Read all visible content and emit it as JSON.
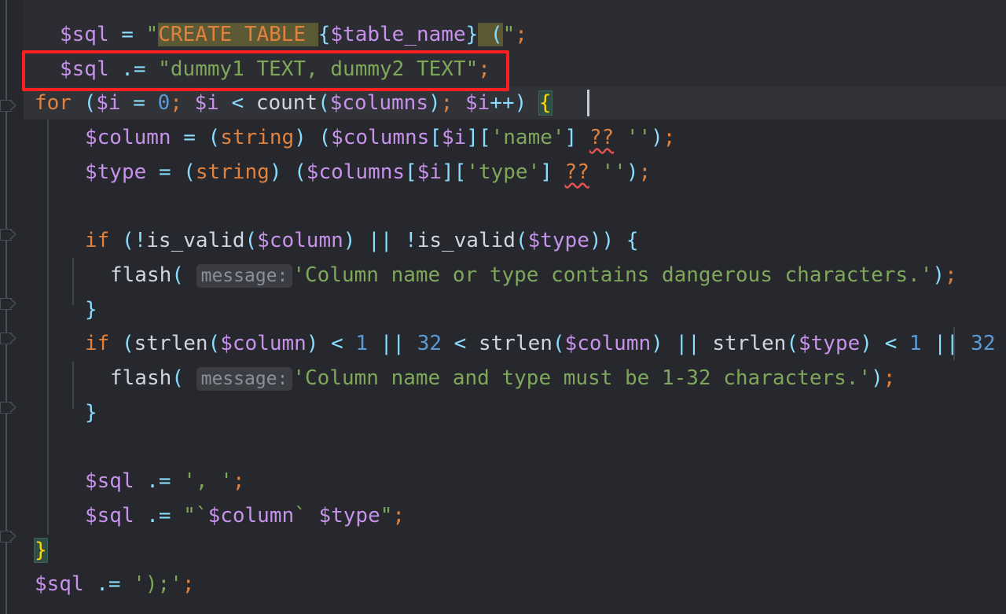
{
  "editor": {
    "language": "php",
    "theme_background": "#26282e",
    "selection_band_background": "#2b2d33",
    "current_line_background": "#313339",
    "annotation_color": "#ff2020",
    "cursor_color": "#c6ccd6",
    "highlight_background": "#5c5a34",
    "brace_match_background": "#2f4f46",
    "inlay_hint_background": "#3b3d43",
    "squiggle_color": "#e05252"
  },
  "annotation": {
    "name": "red-highlight-rectangle",
    "targets_line": 2,
    "label": ""
  },
  "inlay_hints": [
    {
      "text": "message:"
    },
    {
      "text": "message:"
    }
  ],
  "code_lines": [
    {
      "n": 1,
      "indent": 1,
      "text": "$sql = \"CREATE TABLE {$table_name} (\";",
      "tokens": [
        {
          "t": "$sql",
          "c": "var"
        },
        {
          "t": " ",
          "c": "plain"
        },
        {
          "t": "=",
          "c": "op"
        },
        {
          "t": " ",
          "c": "plain"
        },
        {
          "t": "\"",
          "c": "str"
        },
        {
          "t": "CREATE TABLE ",
          "c": "kw",
          "hl": "sql"
        },
        {
          "t": "{",
          "c": "op",
          "hl": "interp"
        },
        {
          "t": "$table_name",
          "c": "strp",
          "hl": "interp"
        },
        {
          "t": "}",
          "c": "op",
          "hl": "interp"
        },
        {
          "t": " (",
          "c": "op",
          "hl": "sql"
        },
        {
          "t": "\"",
          "c": "str"
        },
        {
          "t": ";",
          "c": "semi"
        }
      ]
    },
    {
      "n": 2,
      "indent": 1,
      "text": "$sql .= \"dummy1 TEXT, dummy2 TEXT\";",
      "tokens": [
        {
          "t": "$sql",
          "c": "var"
        },
        {
          "t": " ",
          "c": "plain"
        },
        {
          "t": ".=",
          "c": "op"
        },
        {
          "t": " ",
          "c": "plain"
        },
        {
          "t": "\"dummy1 TEXT, dummy2 TEXT\"",
          "c": "str"
        },
        {
          "t": ";",
          "c": "semi"
        }
      ]
    },
    {
      "n": 3,
      "indent": 0,
      "text": "for ($i = 0; $i < count($columns); $i++) {",
      "tokens": [
        {
          "t": "for",
          "c": "kw"
        },
        {
          "t": " ",
          "c": "plain"
        },
        {
          "t": "(",
          "c": "op"
        },
        {
          "t": "$i",
          "c": "var"
        },
        {
          "t": " ",
          "c": "plain"
        },
        {
          "t": "=",
          "c": "op"
        },
        {
          "t": " ",
          "c": "plain"
        },
        {
          "t": "0",
          "c": "num"
        },
        {
          "t": ";",
          "c": "semi"
        },
        {
          "t": " ",
          "c": "plain"
        },
        {
          "t": "$i",
          "c": "var"
        },
        {
          "t": " ",
          "c": "plain"
        },
        {
          "t": "<",
          "c": "op"
        },
        {
          "t": " ",
          "c": "plain"
        },
        {
          "t": "count",
          "c": "fn"
        },
        {
          "t": "(",
          "c": "op"
        },
        {
          "t": "$columns",
          "c": "var"
        },
        {
          "t": ")",
          "c": "op"
        },
        {
          "t": ";",
          "c": "semi"
        },
        {
          "t": " ",
          "c": "plain"
        },
        {
          "t": "$i",
          "c": "var"
        },
        {
          "t": "++",
          "c": "op"
        },
        {
          "t": ")",
          "c": "op"
        },
        {
          "t": " ",
          "c": "plain"
        },
        {
          "t": "{",
          "c": "brace",
          "hl": "brace"
        }
      ]
    },
    {
      "n": 4,
      "indent": 2,
      "text": "$column = (string) ($columns[$i]['name'] ?? '');",
      "tokens": [
        {
          "t": "$column",
          "c": "var"
        },
        {
          "t": " ",
          "c": "plain"
        },
        {
          "t": "=",
          "c": "op"
        },
        {
          "t": " ",
          "c": "plain"
        },
        {
          "t": "(",
          "c": "op"
        },
        {
          "t": "string",
          "c": "cast"
        },
        {
          "t": ")",
          "c": "op"
        },
        {
          "t": " ",
          "c": "plain"
        },
        {
          "t": "(",
          "c": "op"
        },
        {
          "t": "$columns",
          "c": "var"
        },
        {
          "t": "[",
          "c": "op"
        },
        {
          "t": "$i",
          "c": "var"
        },
        {
          "t": "]",
          "c": "op"
        },
        {
          "t": "[",
          "c": "op"
        },
        {
          "t": "'name'",
          "c": "str"
        },
        {
          "t": "]",
          "c": "op"
        },
        {
          "t": " ",
          "c": "plain"
        },
        {
          "t": "??",
          "c": "kw",
          "squiggle": true
        },
        {
          "t": " ",
          "c": "plain"
        },
        {
          "t": "''",
          "c": "str"
        },
        {
          "t": ")",
          "c": "op"
        },
        {
          "t": ";",
          "c": "semi"
        }
      ]
    },
    {
      "n": 5,
      "indent": 2,
      "text": "$type = (string) ($columns[$i]['type'] ?? '');",
      "tokens": [
        {
          "t": "$type",
          "c": "var"
        },
        {
          "t": " ",
          "c": "plain"
        },
        {
          "t": "=",
          "c": "op"
        },
        {
          "t": " ",
          "c": "plain"
        },
        {
          "t": "(",
          "c": "op"
        },
        {
          "t": "string",
          "c": "cast"
        },
        {
          "t": ")",
          "c": "op"
        },
        {
          "t": " ",
          "c": "plain"
        },
        {
          "t": "(",
          "c": "op"
        },
        {
          "t": "$columns",
          "c": "var"
        },
        {
          "t": "[",
          "c": "op"
        },
        {
          "t": "$i",
          "c": "var"
        },
        {
          "t": "]",
          "c": "op"
        },
        {
          "t": "[",
          "c": "op"
        },
        {
          "t": "'type'",
          "c": "str"
        },
        {
          "t": "]",
          "c": "op"
        },
        {
          "t": " ",
          "c": "plain"
        },
        {
          "t": "??",
          "c": "kw",
          "squiggle": true
        },
        {
          "t": " ",
          "c": "plain"
        },
        {
          "t": "''",
          "c": "str"
        },
        {
          "t": ")",
          "c": "op"
        },
        {
          "t": ";",
          "c": "semi"
        }
      ]
    },
    {
      "n": 6,
      "indent": 0,
      "text": "",
      "tokens": []
    },
    {
      "n": 7,
      "indent": 2,
      "text": "if (!is_valid($column) || !is_valid($type)) {",
      "tokens": [
        {
          "t": "if",
          "c": "kw"
        },
        {
          "t": " ",
          "c": "plain"
        },
        {
          "t": "(!",
          "c": "op"
        },
        {
          "t": "is_valid",
          "c": "fn"
        },
        {
          "t": "(",
          "c": "op"
        },
        {
          "t": "$column",
          "c": "var"
        },
        {
          "t": ")",
          "c": "op"
        },
        {
          "t": " ",
          "c": "plain"
        },
        {
          "t": "||",
          "c": "op"
        },
        {
          "t": " !",
          "c": "op"
        },
        {
          "t": "is_valid",
          "c": "fn"
        },
        {
          "t": "(",
          "c": "op"
        },
        {
          "t": "$type",
          "c": "var"
        },
        {
          "t": "))",
          "c": "op"
        },
        {
          "t": " ",
          "c": "plain"
        },
        {
          "t": "{",
          "c": "op"
        }
      ]
    },
    {
      "n": 8,
      "indent": 3,
      "text": "flash( message: 'Column name or type contains dangerous characters.');",
      "tokens": [
        {
          "t": "flash",
          "c": "fn"
        },
        {
          "t": "(",
          "c": "op"
        },
        {
          "t": " ",
          "c": "plain"
        },
        {
          "t": "message:",
          "c": "inlay"
        },
        {
          "t": "'Column name or type contains dangerous characters.'",
          "c": "str"
        },
        {
          "t": ")",
          "c": "op"
        },
        {
          "t": ";",
          "c": "semi"
        }
      ]
    },
    {
      "n": 9,
      "indent": 2,
      "text": "}",
      "tokens": [
        {
          "t": "}",
          "c": "op"
        }
      ]
    },
    {
      "n": 10,
      "indent": 2,
      "text": "if (strlen($column) < 1 || 32 < strlen($column) || strlen($type) < 1 || 32",
      "tokens": [
        {
          "t": "if",
          "c": "kw"
        },
        {
          "t": " ",
          "c": "plain"
        },
        {
          "t": "(",
          "c": "op"
        },
        {
          "t": "strlen",
          "c": "fn"
        },
        {
          "t": "(",
          "c": "op"
        },
        {
          "t": "$column",
          "c": "var"
        },
        {
          "t": ")",
          "c": "op"
        },
        {
          "t": " ",
          "c": "plain"
        },
        {
          "t": "<",
          "c": "op"
        },
        {
          "t": " ",
          "c": "plain"
        },
        {
          "t": "1",
          "c": "num"
        },
        {
          "t": " ",
          "c": "plain"
        },
        {
          "t": "||",
          "c": "op"
        },
        {
          "t": " ",
          "c": "plain"
        },
        {
          "t": "32",
          "c": "num"
        },
        {
          "t": " ",
          "c": "plain"
        },
        {
          "t": "<",
          "c": "op"
        },
        {
          "t": " ",
          "c": "plain"
        },
        {
          "t": "strlen",
          "c": "fn"
        },
        {
          "t": "(",
          "c": "op"
        },
        {
          "t": "$column",
          "c": "var"
        },
        {
          "t": ")",
          "c": "op"
        },
        {
          "t": " ",
          "c": "plain"
        },
        {
          "t": "||",
          "c": "op"
        },
        {
          "t": " ",
          "c": "plain"
        },
        {
          "t": "strlen",
          "c": "fn"
        },
        {
          "t": "(",
          "c": "op"
        },
        {
          "t": "$type",
          "c": "var"
        },
        {
          "t": ")",
          "c": "op"
        },
        {
          "t": " ",
          "c": "plain"
        },
        {
          "t": "<",
          "c": "op"
        },
        {
          "t": " ",
          "c": "plain"
        },
        {
          "t": "1",
          "c": "num"
        },
        {
          "t": " ",
          "c": "plain"
        },
        {
          "t": "||",
          "c": "op"
        },
        {
          "t": " ",
          "c": "plain"
        },
        {
          "t": "32",
          "c": "num"
        }
      ]
    },
    {
      "n": 11,
      "indent": 3,
      "text": "flash( message: 'Column name and type must be 1-32 characters.');",
      "tokens": [
        {
          "t": "flash",
          "c": "fn"
        },
        {
          "t": "(",
          "c": "op"
        },
        {
          "t": " ",
          "c": "plain"
        },
        {
          "t": "message:",
          "c": "inlay"
        },
        {
          "t": "'Column name and type must be 1-32 characters.'",
          "c": "str"
        },
        {
          "t": ")",
          "c": "op"
        },
        {
          "t": ";",
          "c": "semi"
        }
      ]
    },
    {
      "n": 12,
      "indent": 2,
      "text": "}",
      "tokens": [
        {
          "t": "}",
          "c": "op"
        }
      ]
    },
    {
      "n": 13,
      "indent": 0,
      "text": "",
      "tokens": []
    },
    {
      "n": 14,
      "indent": 2,
      "text": "$sql .= ', ';",
      "tokens": [
        {
          "t": "$sql",
          "c": "var"
        },
        {
          "t": " ",
          "c": "plain"
        },
        {
          "t": ".=",
          "c": "op"
        },
        {
          "t": " ",
          "c": "plain"
        },
        {
          "t": "', '",
          "c": "str"
        },
        {
          "t": ";",
          "c": "semi"
        }
      ]
    },
    {
      "n": 15,
      "indent": 2,
      "text": "$sql .= \"`$column` $type\";",
      "tokens": [
        {
          "t": "$sql",
          "c": "var"
        },
        {
          "t": " ",
          "c": "plain"
        },
        {
          "t": ".=",
          "c": "op"
        },
        {
          "t": " ",
          "c": "plain"
        },
        {
          "t": "\"`",
          "c": "str"
        },
        {
          "t": "$column",
          "c": "strp"
        },
        {
          "t": "` ",
          "c": "str"
        },
        {
          "t": "$type",
          "c": "strp"
        },
        {
          "t": "\"",
          "c": "str"
        },
        {
          "t": ";",
          "c": "semi"
        }
      ]
    },
    {
      "n": 16,
      "indent": 0,
      "text": "}",
      "tokens": [
        {
          "t": "}",
          "c": "brace",
          "hl": "brace"
        }
      ]
    },
    {
      "n": 17,
      "indent": 0,
      "text": "$sql .= ');';",
      "tokens": [
        {
          "t": "$sql",
          "c": "var"
        },
        {
          "t": " ",
          "c": "plain"
        },
        {
          "t": ".=",
          "c": "op"
        },
        {
          "t": " ",
          "c": "plain"
        },
        {
          "t": "');'",
          "c": "str"
        },
        {
          "t": ";",
          "c": "semi"
        }
      ]
    }
  ]
}
